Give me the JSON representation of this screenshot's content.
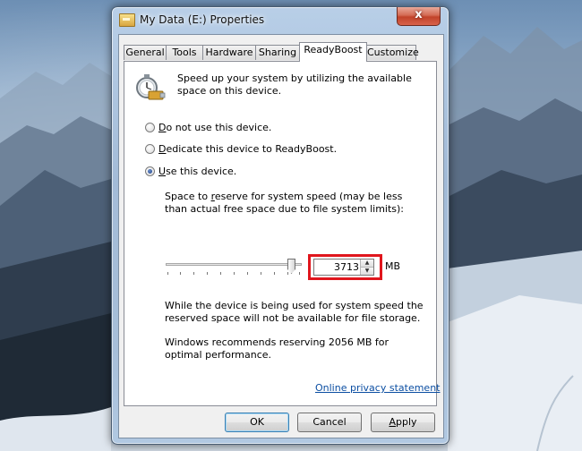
{
  "window": {
    "title": "My Data (E:) Properties",
    "close_glyph": "x"
  },
  "tabs": [
    {
      "label": "General",
      "active": false
    },
    {
      "label": "Tools",
      "active": false
    },
    {
      "label": "Hardware",
      "active": false
    },
    {
      "label": "Sharing",
      "active": false
    },
    {
      "label": "ReadyBoost",
      "active": true
    },
    {
      "label": "Customize",
      "active": false
    }
  ],
  "readyboost": {
    "icon": "stopwatch-usb-icon",
    "intro": "Speed up your system by utilizing the available space on this device.",
    "options": [
      {
        "pre": "",
        "accel": "D",
        "post": "o not use this device.",
        "checked": false
      },
      {
        "pre": "",
        "accel": "D",
        "post": "edicate this device to ReadyBoost.",
        "checked": false
      },
      {
        "pre": "",
        "accel": "U",
        "post": "se this device.",
        "checked": true
      }
    ],
    "space_pre": "Space to ",
    "space_accel": "r",
    "space_post": "eserve for system speed (may be less than actual free space due to file system limits):",
    "slider_level_fraction": 0.95,
    "reserve_value": "3713",
    "unit": "MB",
    "storage_note": "While the device is being used for system speed the reserved space will not be available for file storage.",
    "recommendation": "Windows recommends reserving 2056 MB for optimal performance.",
    "privacy_link": "Online privacy statement"
  },
  "buttons": {
    "ok": "OK",
    "cancel": "Cancel",
    "apply_accel": "A",
    "apply_rest": "pply"
  },
  "colors": {
    "highlight": "#e0161d",
    "link": "#0b4ea2"
  }
}
